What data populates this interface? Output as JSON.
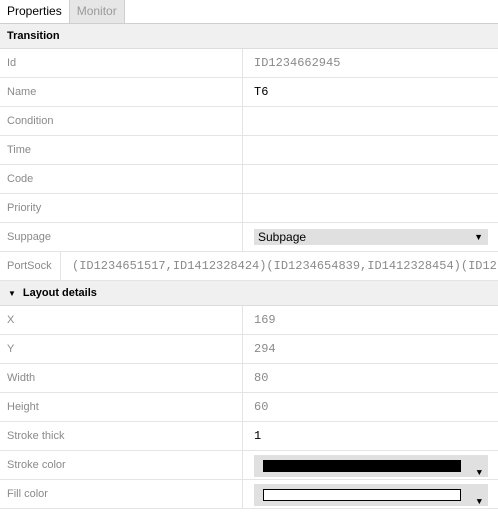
{
  "tabs": [
    {
      "label": "Properties",
      "active": true
    },
    {
      "label": "Monitor",
      "active": false
    }
  ],
  "transition": {
    "header": "Transition",
    "rows": {
      "id": {
        "label": "Id",
        "value": "ID1234662945"
      },
      "name": {
        "label": "Name",
        "value": "T6"
      },
      "condition": {
        "label": "Condition",
        "value": ""
      },
      "time": {
        "label": "Time",
        "value": ""
      },
      "code": {
        "label": "Code",
        "value": ""
      },
      "priority": {
        "label": "Priority",
        "value": ""
      },
      "subpage": {
        "label": "Suppage",
        "value": "Subpage"
      },
      "portsock": {
        "label": "PortSock",
        "value": "(ID1234651517,ID1412328424)(ID1234654839,ID1412328454)(ID12"
      }
    }
  },
  "layout": {
    "header": "Layout details",
    "rows": {
      "x": {
        "label": "X",
        "value": "169"
      },
      "y": {
        "label": "Y",
        "value": "294"
      },
      "width": {
        "label": "Width",
        "value": "80"
      },
      "height": {
        "label": "Height",
        "value": "60"
      },
      "stroke_thick": {
        "label": "Stroke thick",
        "value": "1"
      },
      "stroke_color": {
        "label": "Stroke color",
        "color": "#000000"
      },
      "fill_color": {
        "label": "Fill color",
        "color": "#ffffff"
      }
    }
  },
  "icons": {
    "dropdown_arrow": "▼",
    "collapse_caret": "▼"
  }
}
